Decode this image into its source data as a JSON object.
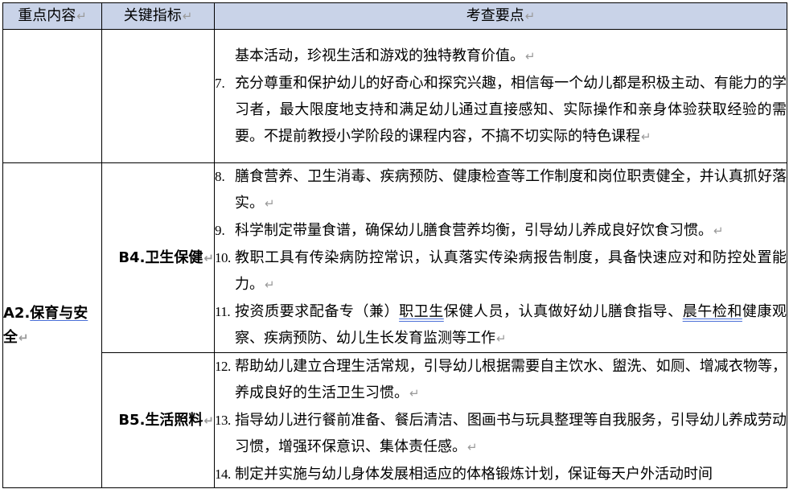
{
  "header": {
    "col_focus": "重点内容",
    "col_indicator": "关键指标",
    "col_points": "考查要点"
  },
  "mark": "↵",
  "row1": {
    "continuation": "基本活动，珍视生活和游戏的独特教育价值。",
    "items": [
      {
        "num": "7.",
        "text": "充分尊重和保护幼儿的好奇心和探究兴趣，相信每一个幼儿都是积极主动、有能力的学习者，最大限度地支持和满足幼儿通过直接感知、实际操作和亲身体验获取经验的需要。不提前教授小学阶段的课程内容，不搞不切实际的特色课程"
      }
    ]
  },
  "focus_a2": {
    "prefix": "A2.",
    "name_underlined": "保育与安",
    "name_rest": "全"
  },
  "b4": {
    "label": "B4.卫生保健",
    "items": [
      {
        "num": "8.",
        "text": "膳食营养、卫生消毒、疾病预防、健康检查等工作制度和岗位职责健全，并认真抓好落实。"
      },
      {
        "num": "9.",
        "text": "科学制定带量食谱，确保幼儿膳食营养均衡，引导幼儿养成良好饮食习惯。"
      },
      {
        "num": "10.",
        "text": "教职工具有传染病防控常识，认真落实传染病报告制度，具备快速应对和防控处置能力。"
      },
      {
        "num": "11.",
        "text_a": "按资质要求配备专（兼）",
        "text_ul1": "职卫生",
        "text_b": "保健人员，认真做好幼儿膳食指导、",
        "text_ul2": "晨午检和",
        "text_c": "健康观察、疾病预防、幼儿生长发育监测等工作"
      }
    ]
  },
  "b5": {
    "label": "B5.生活照料",
    "items": [
      {
        "num": "12.",
        "text": "帮助幼儿建立合理生活常规，引导幼儿根据需要自主饮水、盥洗、如厕、增减衣物等，养成良好的生活卫生习惯。"
      },
      {
        "num": "13.",
        "text": "指导幼儿进行餐前准备、餐后清洁、图画书与玩具整理等自我服务，引导幼儿养成劳动习惯，增强环保意识、集体责任感。"
      },
      {
        "num": "14.",
        "text": "制定并实施与幼儿身体发展相适应的体格锻炼计划，保证每天户外活动时间"
      }
    ]
  }
}
